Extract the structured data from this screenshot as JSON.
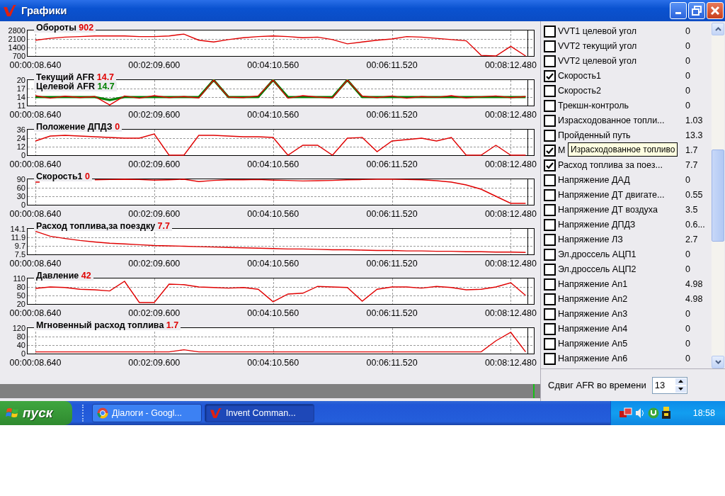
{
  "window": {
    "title": "Графики"
  },
  "charts": [
    {
      "readings": [
        "902"
      ],
      "chart_data": {
        "type": "line",
        "categories": [
          "00:00:08.640",
          null,
          null,
          null,
          null,
          null,
          null,
          null,
          "00:02:09.600",
          null,
          null,
          null,
          null,
          null,
          null,
          null,
          "00:04:10.560",
          null,
          null,
          null,
          null,
          null,
          null,
          null,
          "00:06:11.520",
          null,
          null,
          null,
          null,
          null,
          null,
          null,
          "00:08:12.480",
          null
        ],
        "grid": true,
        "ylim": [
          700,
          2800
        ],
        "yticks": [
          2800,
          2100,
          1400,
          700
        ],
        "series": [
          {
            "name": "Обороты",
            "color": "#e00000",
            "values": [
              2000,
              2150,
              2250,
              2300,
              2350,
              2350,
              2350,
              2300,
              2300,
              2350,
              2500,
              2000,
              1850,
              2050,
              2200,
              2300,
              2350,
              2300,
              2200,
              2250,
              2050,
              1700,
              1850,
              2000,
              2100,
              2300,
              2250,
              2150,
              2050,
              1950,
              750,
              700,
              1500,
              700
            ]
          }
        ]
      }
    },
    {
      "readings": [
        "14.7",
        "14.7"
      ],
      "chart_data": {
        "type": "line",
        "categories": [
          "00:00:08.640",
          null,
          null,
          null,
          null,
          null,
          null,
          null,
          "00:02:09.600",
          null,
          null,
          null,
          null,
          null,
          null,
          null,
          "00:04:10.560",
          null,
          null,
          null,
          null,
          null,
          null,
          null,
          "00:06:11.520",
          null,
          null,
          null,
          null,
          null,
          null,
          null,
          "00:08:12.480",
          null
        ],
        "grid": true,
        "ylim": [
          11,
          20
        ],
        "yticks": [
          20,
          17,
          14,
          11
        ],
        "series": [
          {
            "name": "Текущий AFR",
            "color": "#e00000",
            "values": [
              14.5,
              13.6,
              14.3,
              13.8,
              14.2,
              11.2,
              14.4,
              13.6,
              14.5,
              13.8,
              14.2,
              13.7,
              20,
              14,
              13.8,
              14.4,
              20,
              13.6,
              14.5,
              14,
              13.7,
              20,
              14.3,
              13.8,
              14.4,
              13.6,
              14.2,
              13.9,
              14.5,
              13.7,
              14.1,
              14.4,
              13.8,
              14.2
            ]
          },
          {
            "name": "Целевой AFR",
            "color": "#008000",
            "values": [
              14,
              14,
              14,
              14,
              14,
              13,
              14,
              14,
              14,
              14,
              14,
              14,
              20,
              14,
              14,
              14,
              20,
              14,
              14,
              14,
              14,
              20,
              14,
              14,
              14,
              14,
              14,
              14,
              14,
              14,
              14,
              14,
              14,
              14
            ]
          }
        ]
      }
    },
    {
      "readings": [
        "0"
      ],
      "chart_data": {
        "type": "line",
        "categories": [
          "00:00:08.640",
          null,
          null,
          null,
          null,
          null,
          null,
          null,
          "00:02:09.600",
          null,
          null,
          null,
          null,
          null,
          null,
          null,
          "00:04:10.560",
          null,
          null,
          null,
          null,
          null,
          null,
          null,
          "00:06:11.520",
          null,
          null,
          null,
          null,
          null,
          null,
          null,
          "00:08:12.480",
          null
        ],
        "grid": true,
        "ylim": [
          0,
          36
        ],
        "yticks": [
          36,
          24,
          12,
          0
        ],
        "series": [
          {
            "name": "Положение ДПДЗ",
            "color": "#e00000",
            "values": [
              20,
              27,
              28,
              27,
              26,
              25,
              24,
              24,
              30,
              0,
              0,
              28,
              28,
              27,
              26,
              26,
              25,
              0,
              14,
              14,
              0,
              24,
              25,
              5,
              20,
              22,
              24,
              20,
              25,
              0,
              0,
              14,
              0,
              0
            ]
          }
        ]
      }
    },
    {
      "readings": [
        "0"
      ],
      "chart_data": {
        "type": "line",
        "categories": [
          "00:00:08.640",
          null,
          null,
          null,
          null,
          null,
          null,
          null,
          "00:02:09.600",
          null,
          null,
          null,
          null,
          null,
          null,
          null,
          "00:04:10.560",
          null,
          null,
          null,
          null,
          null,
          null,
          null,
          "00:06:11.520",
          null,
          null,
          null,
          null,
          null,
          null,
          null,
          "00:08:12.480",
          null
        ],
        "grid": true,
        "ylim": [
          0,
          90
        ],
        "yticks": [
          90,
          60,
          30,
          0
        ],
        "series": [
          {
            "name": "Скорость1",
            "color": "#e00000",
            "values": [
              80,
              null,
              null,
              null,
              88,
              89,
              90,
              89,
              87,
              88,
              90,
              82,
              86,
              88,
              88,
              89,
              87,
              86,
              84,
              85,
              86,
              88,
              89,
              90,
              90,
              89,
              88,
              85,
              80,
              70,
              55,
              30,
              5,
              5
            ]
          }
        ]
      }
    },
    {
      "readings": [
        "7.7"
      ],
      "chart_data": {
        "type": "line",
        "categories": [
          "00:00:08.640",
          null,
          null,
          null,
          null,
          null,
          null,
          null,
          "00:02:09.600",
          null,
          null,
          null,
          null,
          null,
          null,
          null,
          "00:04:10.560",
          null,
          null,
          null,
          null,
          null,
          null,
          null,
          "00:06:11.520",
          null,
          null,
          null,
          null,
          null,
          null,
          null,
          "00:08:12.480",
          null
        ],
        "grid": true,
        "ylim": [
          7.5,
          14.1
        ],
        "yticks": [
          14.1,
          11.9,
          9.7,
          7.5
        ],
        "series": [
          {
            "name": "Расход топлива,за поездку",
            "color": "#e00000",
            "values": [
              13.5,
              12.2,
              11.6,
              11.1,
              10.7,
              10.4,
              10.2,
              10,
              9.8,
              9.7,
              9.6,
              9.5,
              9.4,
              9.3,
              9.2,
              9.1,
              9,
              8.9,
              8.9,
              8.8,
              8.7,
              8.7,
              8.6,
              8.5,
              8.5,
              8.4,
              8.4,
              8.3,
              8.3,
              8.2,
              8.2,
              8.1,
              8.1,
              8
            ]
          }
        ]
      }
    },
    {
      "readings": [
        "42"
      ],
      "chart_data": {
        "type": "line",
        "categories": [
          "00:00:08.640",
          null,
          null,
          null,
          null,
          null,
          null,
          null,
          "00:02:09.600",
          null,
          null,
          null,
          null,
          null,
          null,
          null,
          "00:04:10.560",
          null,
          null,
          null,
          null,
          null,
          null,
          null,
          "00:06:11.520",
          null,
          null,
          null,
          null,
          null,
          null,
          null,
          "00:08:12.480",
          null
        ],
        "grid": true,
        "ylim": [
          20,
          110
        ],
        "yticks": [
          110,
          80,
          50,
          20
        ],
        "series": [
          {
            "name": "Давление",
            "color": "#e00000",
            "values": [
              75,
              80,
              78,
              72,
              70,
              66,
              100,
              25,
              25,
              90,
              88,
              80,
              78,
              76,
              78,
              72,
              28,
              55,
              58,
              82,
              80,
              78,
              30,
              72,
              80,
              80,
              76,
              82,
              78,
              70,
              72,
              80,
              95,
              50
            ]
          }
        ]
      }
    },
    {
      "readings": [
        "1.7"
      ],
      "chart_data": {
        "type": "line",
        "categories": [
          "00:00:08.640",
          null,
          null,
          null,
          null,
          null,
          null,
          null,
          "00:02:09.600",
          null,
          null,
          null,
          null,
          null,
          null,
          null,
          "00:04:10.560",
          null,
          null,
          null,
          null,
          null,
          null,
          null,
          "00:06:11.520",
          null,
          null,
          null,
          null,
          null,
          null,
          null,
          "00:08:12.480",
          null
        ],
        "grid": true,
        "ylim": [
          0,
          120
        ],
        "yticks": [
          120,
          80,
          40,
          0
        ],
        "series": [
          {
            "name": "Мгновенный расход топлива",
            "color": "#e00000",
            "values": [
              8,
              8,
              8,
              8,
              8,
              8,
              8,
              8,
              8,
              8,
              18,
              8,
              8,
              8,
              8,
              8,
              8,
              8,
              8,
              8,
              8,
              8,
              8,
              8,
              8,
              8,
              8,
              8,
              8,
              8,
              8,
              60,
              100,
              8
            ]
          }
        ]
      }
    }
  ],
  "channels": [
    {
      "name": "VVT1 целевой угол",
      "value": "0",
      "checked": false
    },
    {
      "name": "VVT2 текущий угол",
      "value": "0",
      "checked": false
    },
    {
      "name": "VVT2 целевой угол",
      "value": "0",
      "checked": false
    },
    {
      "name": "Скорость1",
      "value": "0",
      "checked": true
    },
    {
      "name": "Скорость2",
      "value": "0",
      "checked": false
    },
    {
      "name": "Трекшн-контроль",
      "value": "0",
      "checked": false
    },
    {
      "name": "Израсходованное топли...",
      "value": "1.03",
      "checked": false
    },
    {
      "name": "Пройденный путь",
      "value": "13.3",
      "checked": false
    },
    {
      "name": "М",
      "value": "1.7",
      "checked": true
    },
    {
      "name": "Расход топлива за поез...",
      "value": "7.7",
      "checked": true
    },
    {
      "name": "Напряжение ДАД",
      "value": "0",
      "checked": false
    },
    {
      "name": "Напряжение ДТ двигате...",
      "value": "0.55",
      "checked": false
    },
    {
      "name": "Напряжение ДТ воздуха",
      "value": "3.5",
      "checked": false
    },
    {
      "name": "Напряжение ДПДЗ",
      "value": "0.6...",
      "checked": false
    },
    {
      "name": "Напряжение ЛЗ",
      "value": "2.7",
      "checked": false
    },
    {
      "name": "Эл.дроссель АЦП1",
      "value": "0",
      "checked": false
    },
    {
      "name": "Эл.дроссель АЦП2",
      "value": "0",
      "checked": false
    },
    {
      "name": "Напряжение An1",
      "value": "4.98",
      "checked": false
    },
    {
      "name": "Напряжение An2",
      "value": "4.98",
      "checked": false
    },
    {
      "name": "Напряжение An3",
      "value": "0",
      "checked": false
    },
    {
      "name": "Напряжение An4",
      "value": "0",
      "checked": false
    },
    {
      "name": "Напряжение An5",
      "value": "0",
      "checked": false
    },
    {
      "name": "Напряжение An6",
      "value": "0",
      "checked": false
    }
  ],
  "tooltip": {
    "text": "Израсходованное топливо"
  },
  "afr_shift": {
    "label": "Сдвиг AFR во времени",
    "value": "13"
  },
  "taskbar": {
    "start": "пуск",
    "tasks": [
      {
        "label": "Діалоги - Googl...",
        "kind": "browser",
        "selected": false
      },
      {
        "label": "Invent Comman...",
        "kind": "app",
        "selected": true
      }
    ],
    "clock": "18:58"
  }
}
